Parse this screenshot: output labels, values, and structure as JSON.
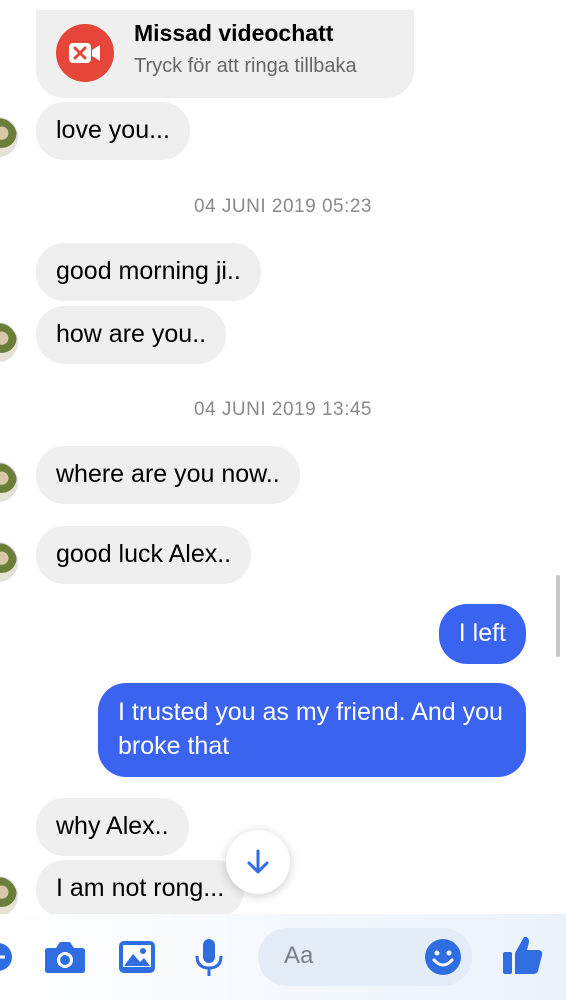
{
  "missed_call": {
    "title": "Missad videochatt",
    "subtitle": "Tryck för att ringa tillbaka"
  },
  "messages": [
    {
      "side": "in",
      "text": "love you..."
    },
    {
      "type": "timestamp",
      "text": "04 JUNI 2019 05:23"
    },
    {
      "side": "in",
      "text": "good morning ji.."
    },
    {
      "side": "in",
      "text": "how are you.."
    },
    {
      "type": "timestamp",
      "text": "04 JUNI 2019 13:45"
    },
    {
      "side": "in",
      "text": "where are you now.."
    },
    {
      "side": "in",
      "text": "good luck  Alex.."
    },
    {
      "side": "out",
      "text": "I left"
    },
    {
      "side": "out",
      "text": "I trusted you as my friend. And you broke that"
    },
    {
      "side": "in",
      "text": "why Alex.."
    },
    {
      "side": "in",
      "text": "I am not rong..."
    }
  ],
  "composer": {
    "placeholder": "Aa",
    "icons": [
      "plus-icon",
      "camera-icon",
      "photo-icon",
      "microphone-icon",
      "emoji-icon",
      "like-icon"
    ],
    "accent": "#2f6de1"
  },
  "colors": {
    "incoming_bubble": "#efefef",
    "outgoing_bubble": "#3a63f0",
    "missed_call_red": "#e6453a"
  }
}
